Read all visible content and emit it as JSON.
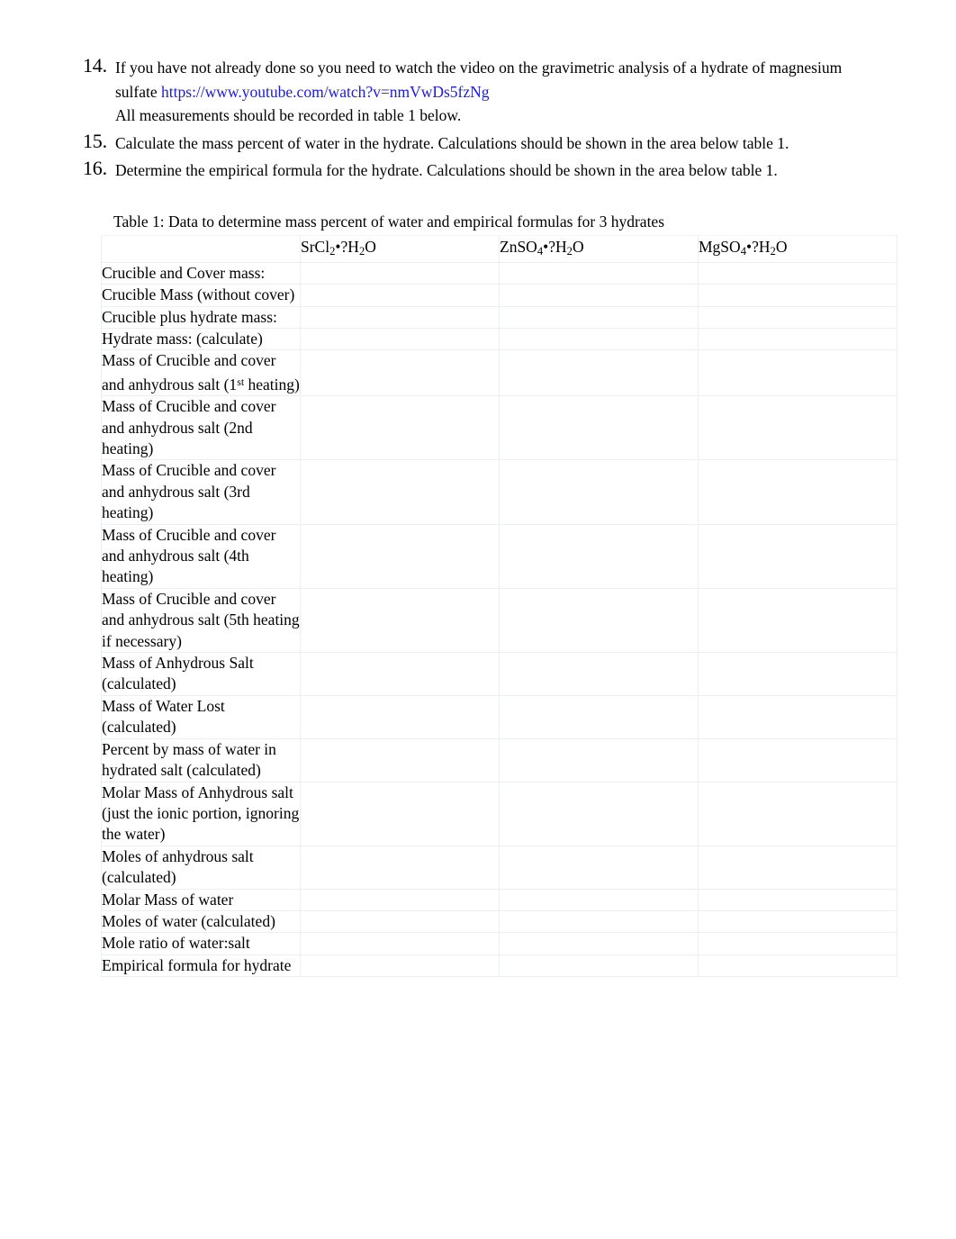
{
  "instructions": [
    {
      "number": "14.",
      "text_before_link": "If you have not already done so you need to watch the video on the gravimetric analysis of a hydrate of magnesium sulfate ",
      "link_text": "https://www.youtube.com/watch?v=nmVwDs5fzNg",
      "sub_text": "All measurements should be recorded in table 1 below."
    },
    {
      "number": "15.",
      "text_before_link": "Calculate the mass percent of water in the hydrate. Calculations should be shown in the area below table 1.",
      "link_text": "",
      "sub_text": ""
    },
    {
      "number": "16.",
      "text_before_link": "Determine the empirical formula for the hydrate. Calculations should be shown in the area below table 1.",
      "link_text": "",
      "sub_text": ""
    }
  ],
  "table": {
    "caption": "Table 1: Data to determine mass percent of water and empirical formulas for 3 hydrates",
    "corner_header": "",
    "column_headers": [
      {
        "formula": "SrCl",
        "sub1": "2",
        "mid": "•?H",
        "sub2": "2",
        "end": "O"
      },
      {
        "formula": "ZnSO",
        "sub1": "4",
        "mid": "•?H",
        "sub2": "2",
        "end": "O"
      },
      {
        "formula": "MgSO",
        "sub1": "4",
        "mid": "•?H",
        "sub2": "2",
        "end": "O"
      }
    ],
    "rows": [
      {
        "label": "Crucible and Cover mass:",
        "values": [
          "",
          "",
          ""
        ]
      },
      {
        "label": "Crucible Mass (without cover)",
        "values": [
          "",
          "",
          ""
        ]
      },
      {
        "label": "Crucible plus hydrate mass:",
        "values": [
          "",
          "",
          ""
        ]
      },
      {
        "label": "Hydrate mass: (calculate)",
        "values": [
          "",
          "",
          ""
        ]
      },
      {
        "label": "Mass of Crucible and cover and anhydrous salt (1st heating)",
        "label_parts": [
          "Mass of Crucible and cover and anhydrous salt (1",
          "st",
          " heating)"
        ],
        "values": [
          "",
          "",
          ""
        ]
      },
      {
        "label": "Mass of Crucible and cover and anhydrous salt (2nd heating)",
        "values": [
          "",
          "",
          ""
        ]
      },
      {
        "label": "Mass of Crucible and cover and anhydrous salt (3rd heating)",
        "values": [
          "",
          "",
          ""
        ]
      },
      {
        "label": "Mass of Crucible and cover and anhydrous salt (4th heating)",
        "values": [
          "",
          "",
          ""
        ]
      },
      {
        "label": "Mass of Crucible and cover and anhydrous salt (5th heating if necessary)",
        "values": [
          "",
          "",
          ""
        ]
      },
      {
        "label": "Mass of Anhydrous Salt (calculated)",
        "values": [
          "",
          "",
          ""
        ]
      },
      {
        "label": "Mass of Water Lost (calculated)",
        "values": [
          "",
          "",
          ""
        ]
      },
      {
        "label": "Percent by mass of water in hydrated salt (calculated)",
        "values": [
          "",
          "",
          ""
        ]
      },
      {
        "label": "Molar Mass of Anhydrous salt (just the ionic portion, ignoring the water)",
        "values": [
          "",
          "",
          ""
        ]
      },
      {
        "label": "Moles of anhydrous salt (calculated)",
        "values": [
          "",
          "",
          ""
        ]
      },
      {
        "label": "Molar Mass of water",
        "values": [
          "",
          "",
          ""
        ]
      },
      {
        "label": "Moles of water (calculated)",
        "values": [
          "",
          "",
          ""
        ]
      },
      {
        "label": "Mole ratio of water:salt",
        "values": [
          "",
          "",
          ""
        ]
      },
      {
        "label": "Empirical formula for hydrate",
        "values": [
          "",
          "",
          ""
        ]
      }
    ]
  }
}
